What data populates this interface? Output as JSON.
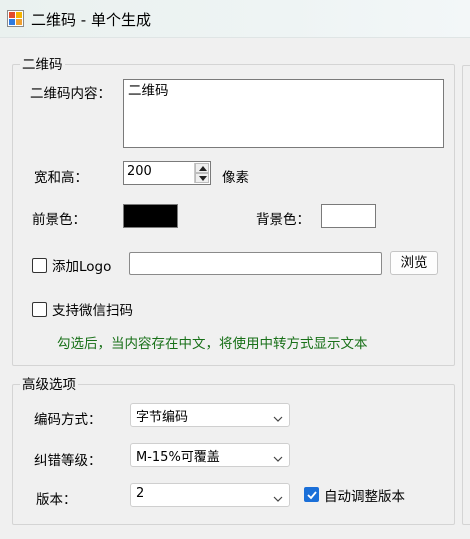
{
  "window": {
    "title": "二维码 - 单个生成"
  },
  "qrcode_group": {
    "legend": "二维码",
    "content_label": "二维码内容：",
    "content_value": "二维码",
    "size_label": "宽和高：",
    "size_value": "200",
    "size_unit": "像素",
    "fg_label": "前景色：",
    "fg_color": "#000000",
    "bg_label": "背景色：",
    "bg_color": "#ffffff",
    "logo_label": "添加Logo",
    "logo_path": "",
    "browse_label": "浏览",
    "wechat_label": "支持微信扫码",
    "hint": "勾选后，当内容存在中文，将使用中转方式显示文本"
  },
  "advanced_group": {
    "legend": "高级选项",
    "encoding_label": "编码方式：",
    "encoding_value": "字节编码",
    "ecc_label": "纠错等级：",
    "ecc_value": "M-15%可覆盖",
    "version_label": "版本：",
    "version_value": "2",
    "auto_version_label": "自动调整版本",
    "auto_version_checked": true
  },
  "colors": {
    "accent": "#1a6fd8",
    "hint_text": "#187018"
  }
}
